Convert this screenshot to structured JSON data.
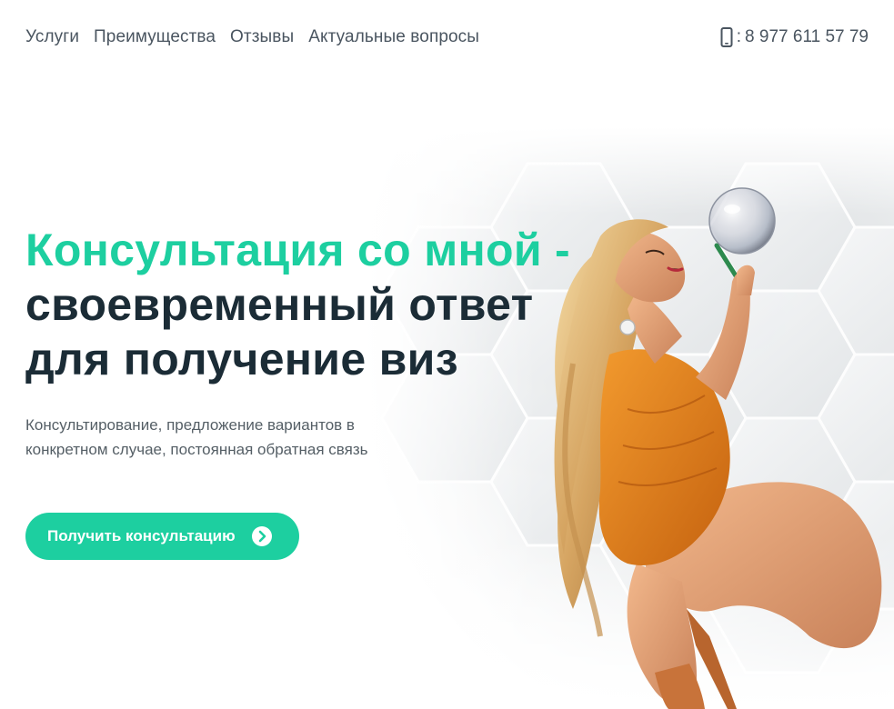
{
  "nav": {
    "items": [
      {
        "label": "Услуги"
      },
      {
        "label": "Преимущества"
      },
      {
        "label": "Отзывы"
      },
      {
        "label": "Актуальные вопросы"
      }
    ]
  },
  "contact": {
    "icon": "mobile-phone-icon",
    "separator": ":",
    "phone": "8 977 611 57 79"
  },
  "hero": {
    "title_accent": "Консультация со мной -",
    "title_line2": "своевременный ответ",
    "title_line3": "для получение виз",
    "description": "Консультирование, предложение вариантов в конкретном случае, постоянная обратная связь",
    "cta_label": "Получить консультацию",
    "cta_icon": "chevron-right-circle-icon"
  },
  "colors": {
    "accent": "#1dcfa0",
    "heading": "#1b2c36",
    "text": "#555f66",
    "nav": "#4a5560",
    "dress": "#e8841c"
  }
}
